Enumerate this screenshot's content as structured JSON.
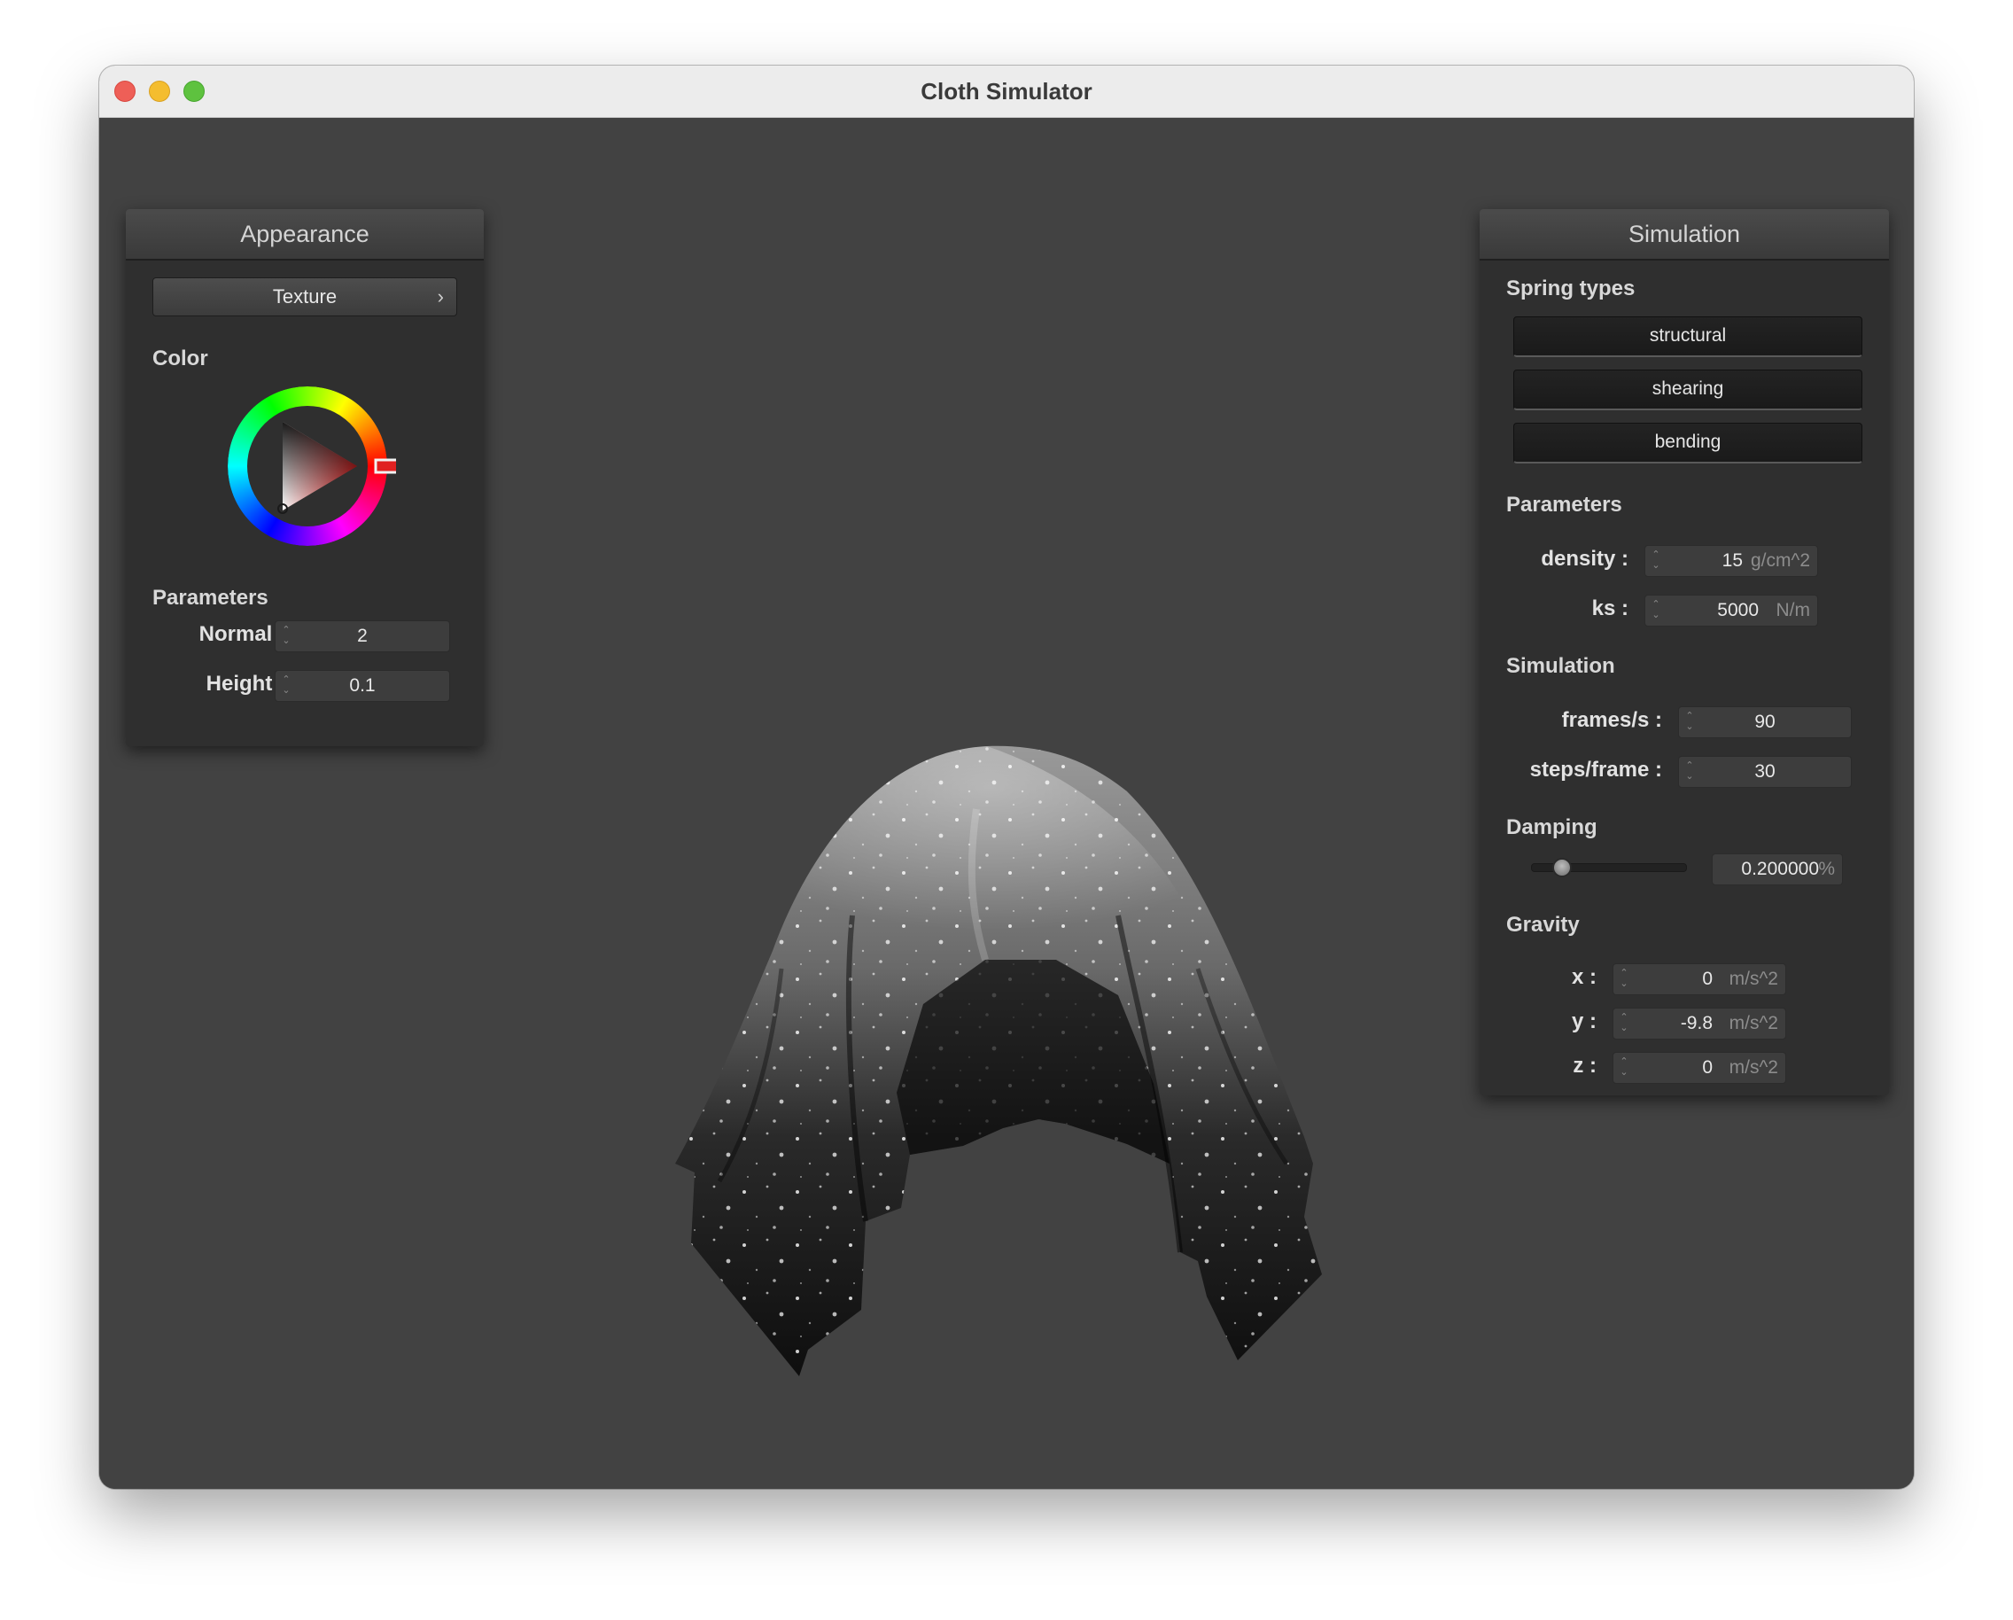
{
  "window": {
    "title": "Cloth Simulator"
  },
  "appearance": {
    "header": "Appearance",
    "texture_button": "Texture",
    "color_label": "Color",
    "parameters_label": "Parameters",
    "normal": {
      "label": "Normal :",
      "value": "2"
    },
    "height": {
      "label": "Height :",
      "value": "0.1"
    },
    "selected_color": "#e02020"
  },
  "simulation": {
    "header": "Simulation",
    "spring_types_label": "Spring types",
    "spring_types": [
      "structural",
      "shearing",
      "bending"
    ],
    "parameters_label": "Parameters",
    "density": {
      "label": "density :",
      "value": "15",
      "unit": "g/cm^2"
    },
    "ks": {
      "label": "ks :",
      "value": "5000",
      "unit": "N/m"
    },
    "simulation_label": "Simulation",
    "frames": {
      "label": "frames/s :",
      "value": "90"
    },
    "steps": {
      "label": "steps/frame :",
      "value": "30"
    },
    "damping_label": "Damping",
    "damping": {
      "value": "0.200000",
      "unit": "%",
      "slider_fraction": 0.2
    },
    "gravity_label": "Gravity",
    "gravity": [
      {
        "label": "x :",
        "value": "0",
        "unit": "m/s^2"
      },
      {
        "label": "y :",
        "value": "-9.8",
        "unit": "m/s^2"
      },
      {
        "label": "z :",
        "value": "0",
        "unit": "m/s^2"
      }
    ]
  }
}
